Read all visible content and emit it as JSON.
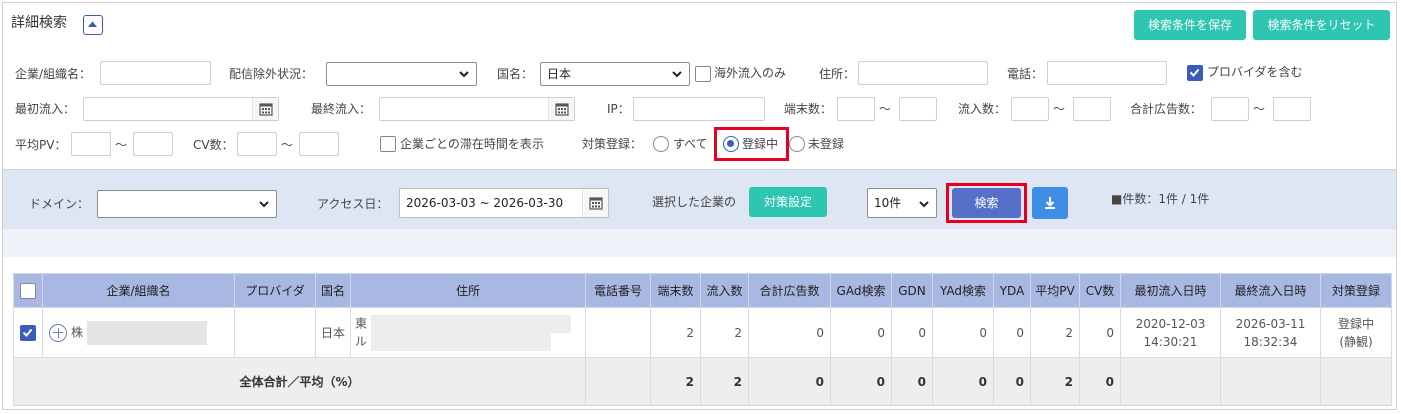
{
  "header": {
    "title": "詳細検索",
    "save_label": "検索条件を保存",
    "reset_label": "検索条件をリセット"
  },
  "filters": {
    "company_label": "企業/組織名：",
    "company_value": "",
    "delivery_exclusion_label": "配信除外状況：",
    "delivery_exclusion_value": "",
    "country_label": "国名：",
    "country_value": "日本",
    "overseas_only_label": "海外流入のみ",
    "overseas_only_checked": false,
    "address_label": "住所：",
    "address_value": "",
    "phone_label": "電話：",
    "phone_value": "",
    "include_provider_label": "プロバイダを含む",
    "include_provider_checked": true,
    "first_inflow_label": "最初流入：",
    "first_inflow_value": "",
    "last_inflow_label": "最終流入：",
    "last_inflow_value": "",
    "ip_label": "IP：",
    "ip_value": "",
    "terminal_count_label": "端末数：",
    "inflow_count_label": "流入数：",
    "total_ads_label": "合計広告数：",
    "avg_pv_label": "平均PV：",
    "cv_count_label": "CV数：",
    "range_sep": "～",
    "dwell_time_label": "企業ごとの滞在時間を表示",
    "dwell_time_checked": false,
    "measure_label": "対策登録：",
    "measure_options": [
      "すべて",
      "登録中",
      "未登録"
    ],
    "measure_selected": "登録中"
  },
  "search_bar": {
    "domain_label": "ドメイン：",
    "domain_value": "",
    "access_date_label": "アクセス日：",
    "access_date_value": "2026-03-03 ~ 2026-03-30",
    "selected_companies_label": "選択した企業の",
    "measure_setting_label": "対策設定",
    "per_page_value": "10件",
    "search_label": "検索",
    "count_text": "■件数：1件 / 1件"
  },
  "table": {
    "columns": [
      "企業/組織名",
      "プロバイダ",
      "国名",
      "住所",
      "電話番号",
      "端末数",
      "流入数",
      "合計広告数",
      "GAd検索",
      "GDN",
      "YAd検索",
      "YDA",
      "平均PV",
      "CV数",
      "最初流入日時",
      "最終流入日時",
      "対策登録"
    ],
    "rows": [
      {
        "checked": true,
        "company": "株",
        "provider": "",
        "country": "日本",
        "address_line1": "東",
        "address_line2": "ル",
        "phone": "",
        "terminals": "2",
        "inflows": "2",
        "total_ads": "0",
        "gad_search": "0",
        "gdn": "0",
        "yad_search": "0",
        "yda": "0",
        "avg_pv": "2",
        "cv": "0",
        "first_date": "2020-12-03",
        "first_time": "14:30:21",
        "last_date": "2026-03-11",
        "last_time": "18:32:34",
        "measure_status": "登録中",
        "measure_note": "(静観)"
      }
    ],
    "total": {
      "label": "全体合計／平均（%）",
      "terminals": "2",
      "inflows": "2",
      "total_ads": "0",
      "gad_search": "0",
      "gdn": "0",
      "yad_search": "0",
      "yda": "0",
      "avg_pv": "2",
      "cv": "0"
    }
  },
  "colors": {
    "accent_teal": "#2ec5b1",
    "primary_blue": "#5670c8",
    "highlight_red": "#e6001f",
    "header_row": "#a9b8e2"
  }
}
